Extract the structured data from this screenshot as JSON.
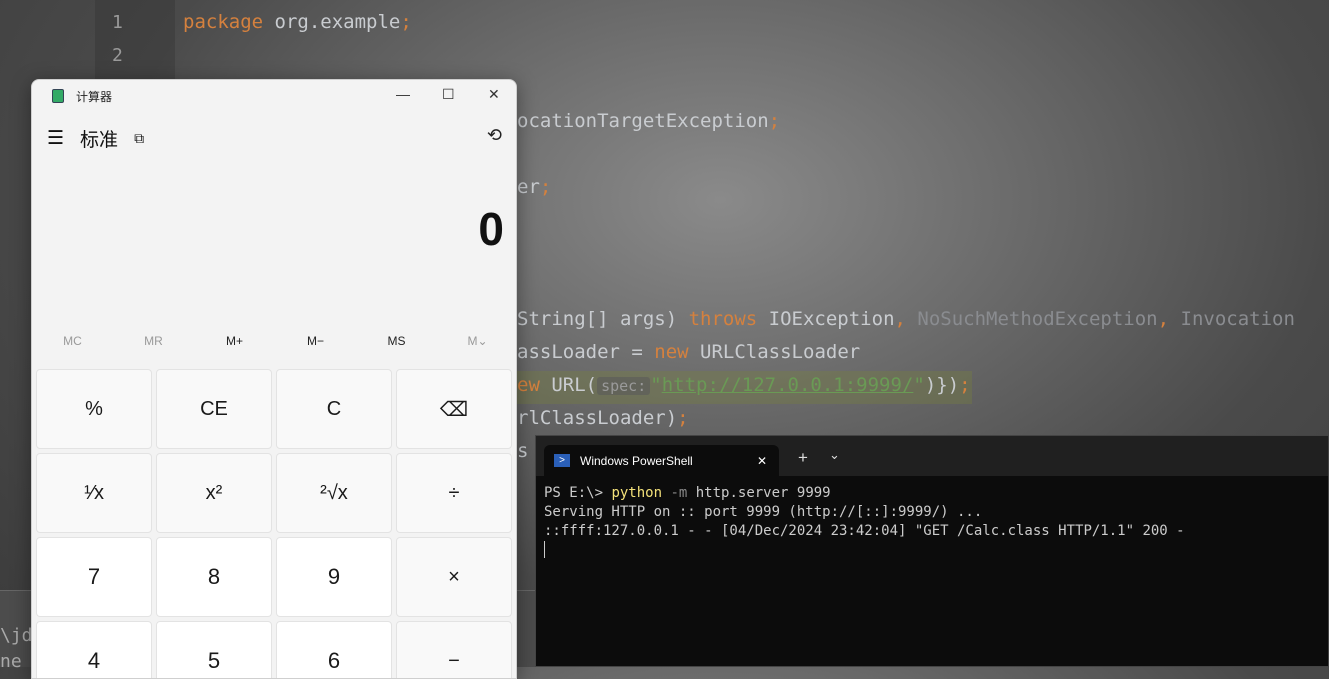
{
  "editor": {
    "line_numbers": [
      "1",
      "2"
    ],
    "lines": {
      "l1": {
        "kw": "package",
        "rest": " org.example",
        "semi": ";"
      },
      "l4": {
        "text": "ocationTargetException",
        "semi": ";"
      },
      "l6": {
        "text": "er",
        "semi": ";"
      },
      "l10": {
        "a": "String[] args) ",
        "kw": "throws",
        "b": " IOException",
        "c": ", ",
        "d": "NoSuchMethodException",
        "e": ", ",
        "f": "Invocation"
      },
      "l11": {
        "a": "assLoader = ",
        "kw": "new",
        "b": " URLClassLoader"
      },
      "l12": {
        "kw": "ew",
        "a": " URL(",
        "hint": "spec:",
        "str_q1": "\"",
        "str": "http://127.0.0.1:9999/",
        "str_q2": "\"",
        "b": ")})",
        "semi": ";"
      },
      "l13": {
        "a": "rlClassLoader)",
        "semi": ";"
      },
      "l14": {
        "a": "s"
      }
    },
    "bottom_panel": [
      "\\jd",
      "ne"
    ]
  },
  "calculator": {
    "title": "计算器",
    "mode": "标准",
    "display": "0",
    "memory": [
      "MC",
      "MR",
      "M+",
      "M−",
      "MS",
      "M⌄"
    ],
    "buttons": [
      "%",
      "CE",
      "C",
      "⌫",
      "¹⁄x",
      "x²",
      "²√x",
      "÷",
      "7",
      "8",
      "9",
      "×",
      "4",
      "5",
      "6",
      "−"
    ]
  },
  "powershell": {
    "tab_title": "Windows PowerShell",
    "new_tab": "+",
    "dropdown": "⌄",
    "close": "✕",
    "lines": {
      "prompt": "PS E:\\> ",
      "cmd": "python",
      "flag": " -m",
      "args": " http.server 9999",
      "l2": "Serving HTTP on :: port 9999 (http://[::]:9999/) ...",
      "l3": "::ffff:127.0.0.1 - - [04/Dec/2024 23:42:04] \"GET /Calc.class HTTP/1.1\" 200 -"
    }
  }
}
